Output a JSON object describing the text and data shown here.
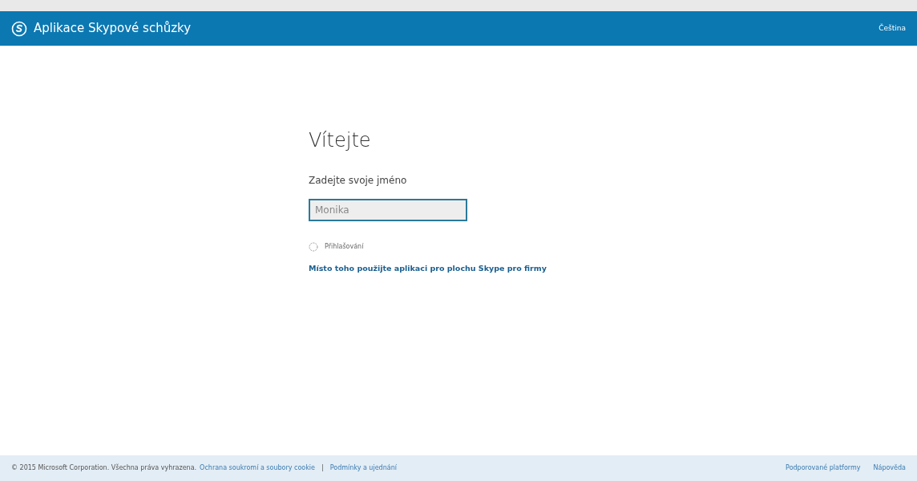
{
  "header": {
    "title": "Aplikace Skypové schůzky",
    "language": "Čeština"
  },
  "main": {
    "heading": "Vítejte",
    "name_label": "Zadejte svoje jméno",
    "name_field": {
      "value": "Monika"
    },
    "status": "Přihlašování",
    "desktop_link": "Místo toho použijte aplikaci pro plochu Skype pro firmy"
  },
  "footer": {
    "copyright": "© 2015 Microsoft Corporation. Všechna práva vyhrazena.",
    "left_links": [
      "Ochrana soukromí a soubory cookie",
      "Podmínky a ujednání"
    ],
    "separator": "|",
    "right_links": [
      "Podporované platformy",
      "Nápověda"
    ]
  }
}
